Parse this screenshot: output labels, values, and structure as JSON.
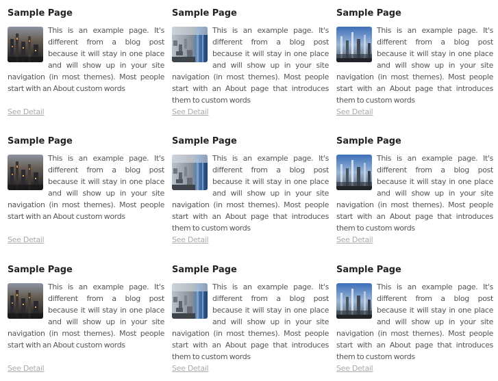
{
  "cards": [
    {
      "title": "Sample Page",
      "excerpt": "This is an example page. It's different from a blog post because it will stay in one place and will show up in your site navigation (in most themes). Most people start with an About custom words",
      "link_label": "See Detail",
      "thumbnail": "city-night-thumbnail"
    },
    {
      "title": "Sample Page",
      "excerpt": "This is an example page. It's different from a blog post because it will stay in one place and will show up in your site navigation (in most themes). Most people start with an About page that introduces them to custom words",
      "link_label": "See Detail",
      "thumbnail": "city-aerial-thumbnail"
    },
    {
      "title": "Sample Page",
      "excerpt": "This is an example page. It's different from a blog post because it will stay in one place and will show up in your site navigation (in most themes). Most people start with an About page that introduces them to custom words",
      "link_label": "See Detail",
      "thumbnail": "city-skyline-thumbnail"
    },
    {
      "title": "Sample Page",
      "excerpt": "This is an example page. It's different from a blog post because it will stay in one place and will show up in your site navigation (in most themes). Most people start with an About custom words",
      "link_label": "See Detail",
      "thumbnail": "city-night-thumbnail"
    },
    {
      "title": "Sample Page",
      "excerpt": "This is an example page. It's different from a blog post because it will stay in one place and will show up in your site navigation (in most themes). Most people start with an About page that introduces them to custom words",
      "link_label": "See Detail",
      "thumbnail": "city-aerial-thumbnail"
    },
    {
      "title": "Sample Page",
      "excerpt": "This is an example page. It's different from a blog post because it will stay in one place and will show up in your site navigation (in most themes). Most people start with an About page that introduces them to custom words",
      "link_label": "See Detail",
      "thumbnail": "city-skyline-thumbnail"
    },
    {
      "title": "Sample Page",
      "excerpt": "This is an example page. It's different from a blog post because it will stay in one place and will show up in your site navigation (in most themes). Most people start with an About custom words",
      "link_label": "See Detail",
      "thumbnail": "city-night-thumbnail"
    },
    {
      "title": "Sample Page",
      "excerpt": "This is an example page. It's different from a blog post because it will stay in one place and will show up in your site navigation (in most themes). Most people start with an About page that introduces them to custom words",
      "link_label": "See Detail",
      "thumbnail": "city-aerial-thumbnail"
    },
    {
      "title": "Sample Page",
      "excerpt": "This is an example page. It's different from a blog post because it will stay in one place and will show up in your site navigation (in most themes). Most people start with an About page that introduces them to custom words",
      "link_label": "See Detail",
      "thumbnail": "city-skyline-thumbnail"
    }
  ],
  "colors": {
    "title": "#222222",
    "body_text": "#555555",
    "link": "#aaaaaa",
    "background": "#ffffff"
  }
}
